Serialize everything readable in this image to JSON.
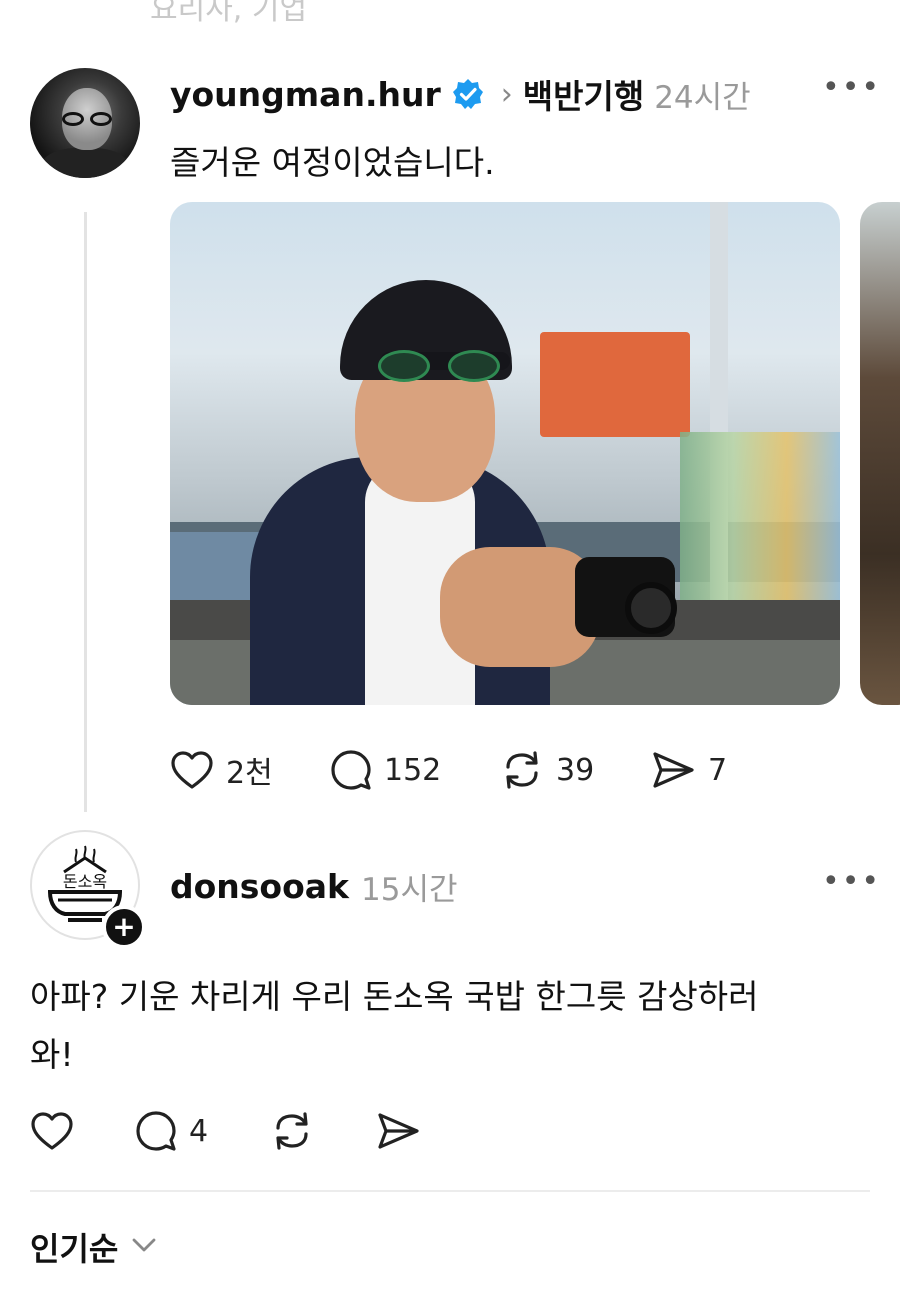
{
  "cutoff_text": "요리사, 기업",
  "post1": {
    "username": "youngman.hur",
    "verified": true,
    "community": "백반기행",
    "time": "24시간",
    "text": "즐거운 여정이었습니다.",
    "likes": "2천",
    "comments": "152",
    "reposts": "39",
    "shares": "7"
  },
  "post2": {
    "username": "donsooak",
    "time": "15시간",
    "text_line1": "아파? 기운 차리게 우리 돈소옥 국밥 한그릇 감상하러",
    "text_line2": "와!",
    "likes": "",
    "comments": "4",
    "reposts": "",
    "shares": "",
    "avatar_logo_text": "돈소옥"
  },
  "sort": {
    "label": "인기순"
  },
  "colors": {
    "verified_blue": "#1d9bf0",
    "muted": "#9a9a9a"
  }
}
